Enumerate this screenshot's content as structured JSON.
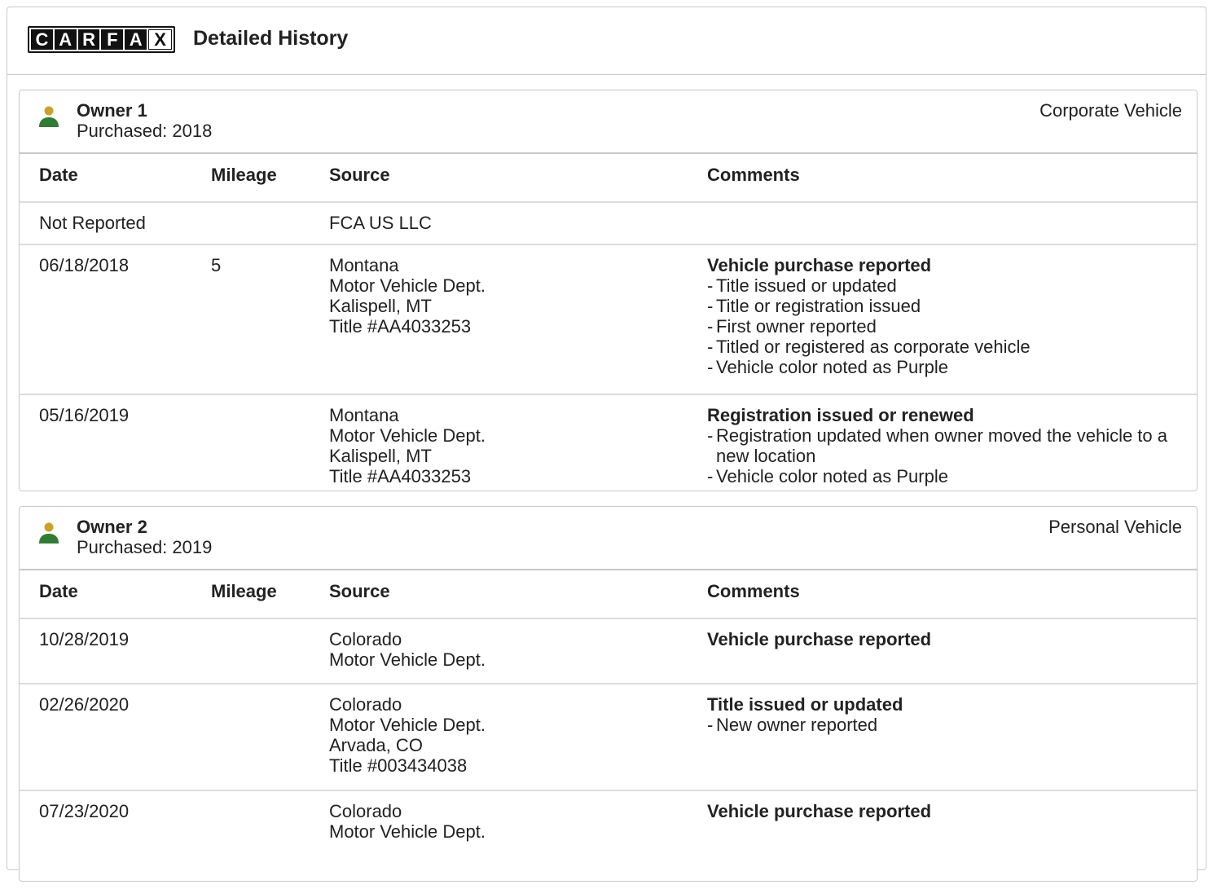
{
  "header": {
    "logo_letters": [
      "C",
      "A",
      "R",
      "F",
      "A",
      "X"
    ],
    "title": "Detailed History"
  },
  "columns": {
    "date": "Date",
    "mileage": "Mileage",
    "source": "Source",
    "comments": "Comments"
  },
  "owners": [
    {
      "name": "Owner 1",
      "purchased": "Purchased: 2018",
      "type": "Corporate Vehicle",
      "records": [
        {
          "date": "Not Reported",
          "mileage": "",
          "source": [
            "FCA US LLC"
          ],
          "comment_title": "",
          "comment_items": []
        },
        {
          "date": "06/18/2018",
          "mileage": "5",
          "source": [
            "Montana",
            "Motor Vehicle Dept.",
            "Kalispell, MT",
            "Title #AA4033253"
          ],
          "comment_title": "Vehicle purchase reported",
          "comment_items": [
            "Title issued or updated",
            "Title or registration issued",
            "First owner reported",
            "Titled or registered as corporate vehicle",
            "Vehicle color noted as Purple"
          ]
        },
        {
          "date": "05/16/2019",
          "mileage": "",
          "source": [
            "Montana",
            "Motor Vehicle Dept.",
            "Kalispell, MT",
            "Title #AA4033253"
          ],
          "comment_title": "Registration issued or renewed",
          "comment_items": [
            "Registration updated when owner moved the vehicle to a new location",
            "Vehicle color noted as Purple"
          ]
        }
      ]
    },
    {
      "name": "Owner 2",
      "purchased": "Purchased: 2019",
      "type": "Personal Vehicle",
      "records": [
        {
          "date": "10/28/2019",
          "mileage": "",
          "source": [
            "Colorado",
            "Motor Vehicle Dept."
          ],
          "comment_title": "Vehicle purchase reported",
          "comment_items": []
        },
        {
          "date": "02/26/2020",
          "mileage": "",
          "source": [
            "Colorado",
            "Motor Vehicle Dept.",
            "Arvada, CO",
            "Title #003434038"
          ],
          "comment_title": "Title issued or updated",
          "comment_items": [
            "New owner reported"
          ]
        },
        {
          "date": "07/23/2020",
          "mileage": "",
          "source": [
            "Colorado",
            "Motor Vehicle Dept."
          ],
          "comment_title": "Vehicle purchase reported",
          "comment_items": []
        }
      ]
    }
  ],
  "colors": {
    "icon_head": "#c9a227",
    "icon_body": "#2e7d32",
    "border": "#c8c8c8"
  },
  "icons": {
    "owner": "person-icon"
  }
}
